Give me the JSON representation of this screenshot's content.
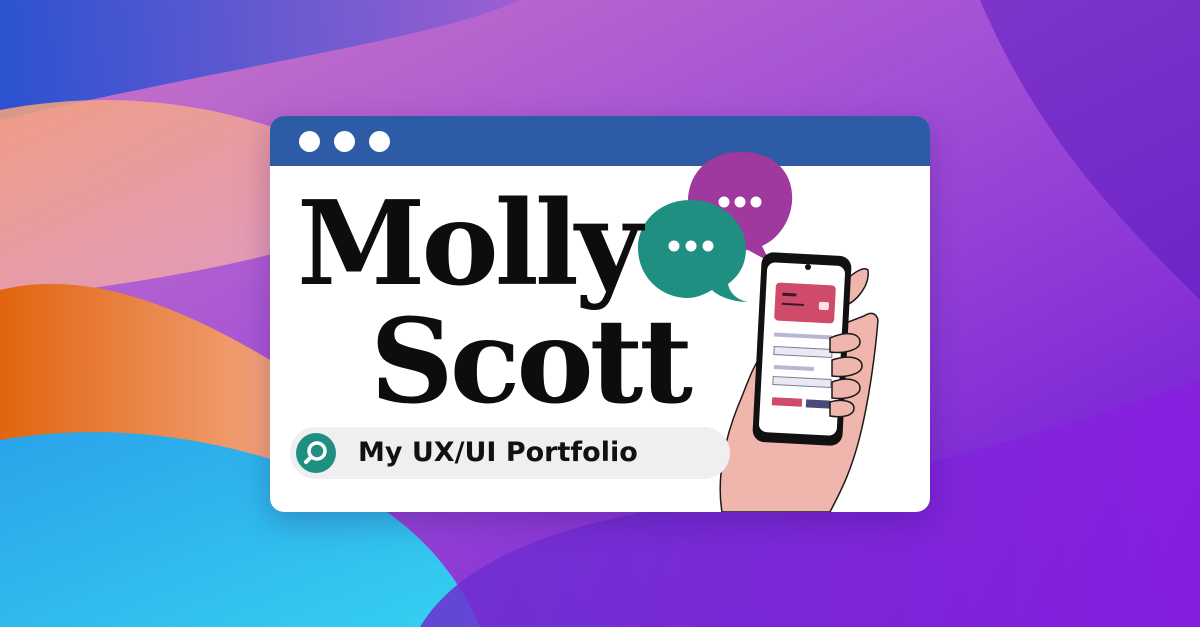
{
  "card": {
    "name_line1": "Molly",
    "name_line2": "Scott",
    "search_label": "My UX/UI Portfolio"
  },
  "colors": {
    "titlebar": "#2e5ba6",
    "accent_teal": "#1f8f82",
    "accent_purple": "#a0399e",
    "phone_card": "#d04a6a",
    "hand": "#f0b6ad"
  },
  "icons": [
    "window-dot-icon",
    "search-icon",
    "chat-bubble-icon",
    "phone-icon",
    "hand-icon"
  ]
}
